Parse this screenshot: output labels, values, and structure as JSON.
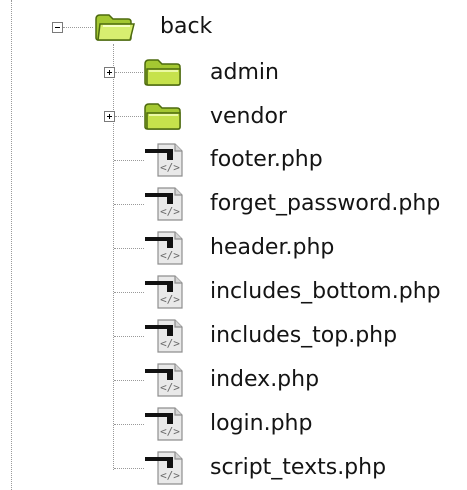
{
  "tree": {
    "root": {
      "label": "back",
      "icon": "folder-open-icon",
      "expanded": true
    },
    "folders": [
      {
        "label": "admin",
        "icon": "folder-icon",
        "expanded": false
      },
      {
        "label": "vendor",
        "icon": "folder-icon",
        "expanded": false
      }
    ],
    "files": [
      {
        "label": "footer.php",
        "icon": "php-file-icon"
      },
      {
        "label": "forget_password.php",
        "icon": "php-file-icon"
      },
      {
        "label": "header.php",
        "icon": "php-file-icon"
      },
      {
        "label": "includes_bottom.php",
        "icon": "php-file-icon"
      },
      {
        "label": "includes_top.php",
        "icon": "php-file-icon"
      },
      {
        "label": "index.php",
        "icon": "php-file-icon"
      },
      {
        "label": "login.php",
        "icon": "php-file-icon"
      },
      {
        "label": "script_texts.php",
        "icon": "php-file-icon"
      }
    ]
  },
  "colors": {
    "folder_body": "#a4c832",
    "folder_light": "#d7ee70",
    "folder_outline": "#4d6a0e",
    "text": "#141414",
    "connector": "#9a9a9a"
  }
}
